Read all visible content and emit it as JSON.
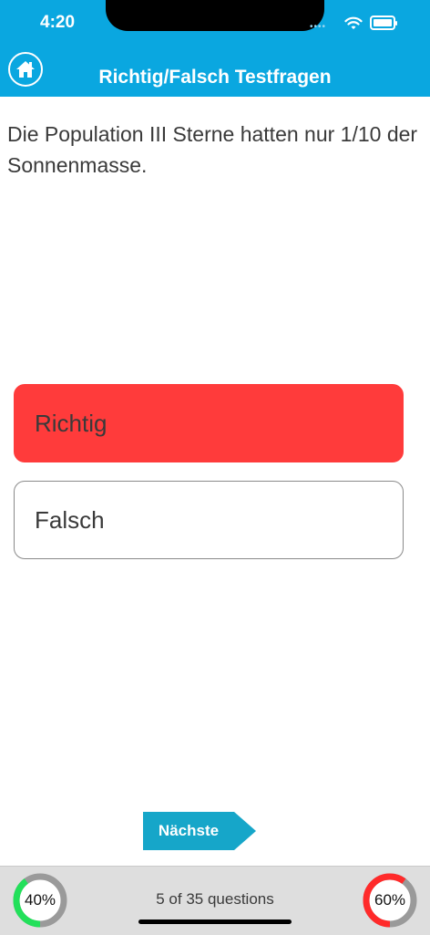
{
  "status_bar": {
    "time": "4:20"
  },
  "header": {
    "title": "Richtig/Falsch Testfragen",
    "home_icon": "home-icon"
  },
  "question": {
    "text": "Die Population III Sterne hatten nur 1/10 der Sonnenmasse."
  },
  "answers": [
    {
      "label": "Richtig",
      "state": "selected-wrong",
      "color": "#ff3b3b"
    },
    {
      "label": "Falsch",
      "state": "unselected"
    }
  ],
  "next_button": {
    "label": "Nächste"
  },
  "footer": {
    "progress_text": "5 of 35 questions",
    "correct_gauge": {
      "label": "40%",
      "value": 0.4,
      "color": "#22e05a"
    },
    "wrong_gauge": {
      "label": "60%",
      "value": 0.6,
      "color": "#ff2a2a"
    }
  },
  "colors": {
    "header": "#0aa7e0",
    "next_button": "#16a6c9"
  }
}
